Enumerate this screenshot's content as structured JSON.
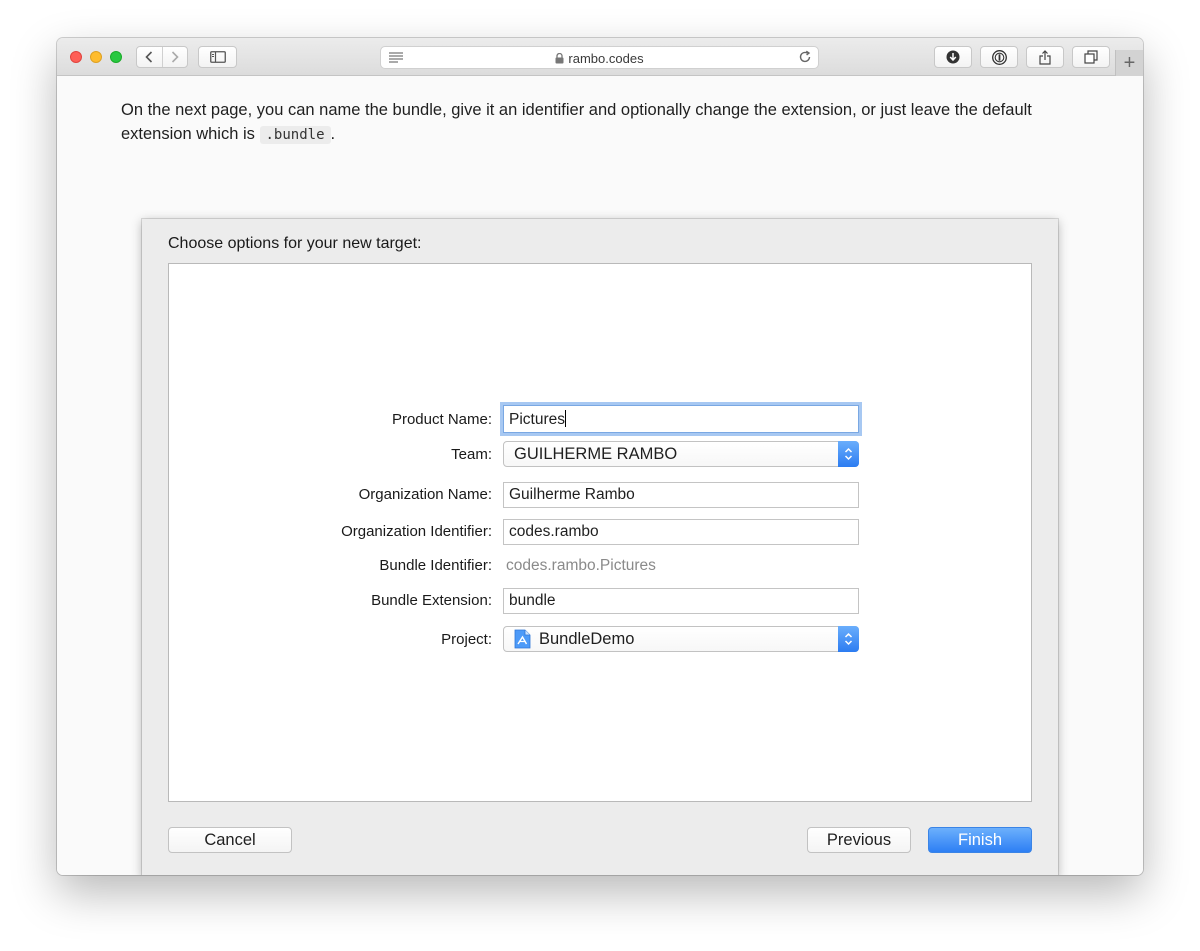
{
  "browser": {
    "url": "rambo.codes",
    "new_tab_glyph": "+",
    "icons": [
      "back-icon",
      "forward-icon",
      "sidebar-icon",
      "reader-icon",
      "lock-icon",
      "reload-icon",
      "download-icon",
      "password-icon",
      "share-icon",
      "tabs-icon"
    ]
  },
  "article": {
    "intro_before": "On the next page, you can name the bundle, give it an identifier and optionally change the extension, or just leave the default extension which is ",
    "intro_code": ".bundle",
    "intro_after": "."
  },
  "dialog": {
    "title": "Choose options for your new target:",
    "fields": {
      "product_name": {
        "label": "Product Name:",
        "value": "Pictures"
      },
      "team": {
        "label": "Team:",
        "value": "GUILHERME RAMBO"
      },
      "organization_name": {
        "label": "Organization Name:",
        "value": "Guilherme Rambo"
      },
      "organization_identifier": {
        "label": "Organization Identifier:",
        "value": "codes.rambo"
      },
      "bundle_identifier": {
        "label": "Bundle Identifier:",
        "value": "codes.rambo.Pictures"
      },
      "bundle_extension": {
        "label": "Bundle Extension:",
        "value": "bundle"
      },
      "project": {
        "label": "Project:",
        "value": "BundleDemo"
      }
    },
    "buttons": {
      "cancel": "Cancel",
      "previous": "Previous",
      "finish": "Finish"
    }
  },
  "colors": {
    "accent": "#2d7ff4",
    "traffic_red": "#fe5f57",
    "traffic_yellow": "#febc2e",
    "traffic_green": "#28c840"
  }
}
